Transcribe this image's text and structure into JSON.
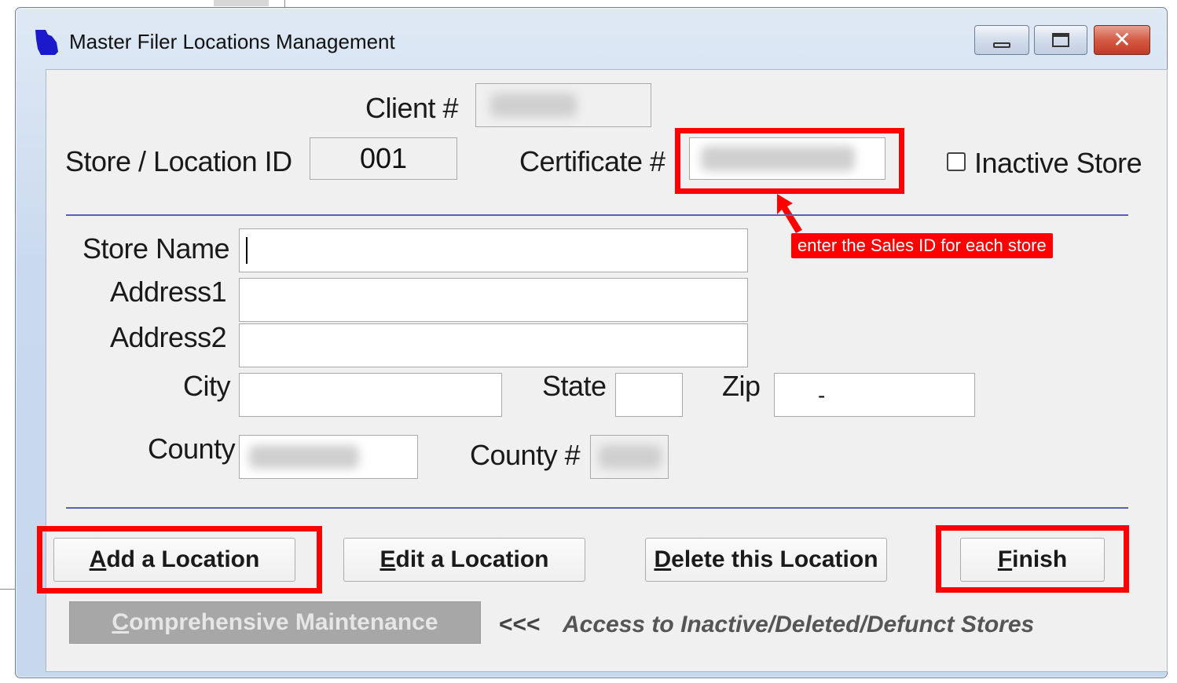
{
  "window": {
    "title": "Master Filer Locations Management",
    "minimize_glyph": "",
    "close_glyph": "✕"
  },
  "header": {
    "client_label": "Client #",
    "store_id_label": "Store / Location ID",
    "store_id_value": "001",
    "certificate_label": "Certificate #",
    "inactive_label": "Inactive Store"
  },
  "annotation": {
    "callout_text": "enter the Sales ID for each store",
    "highlight_color": "#ff0000"
  },
  "form": {
    "store_name_label": "Store Name",
    "address1_label": "Address1",
    "address2_label": "Address2",
    "city_label": "City",
    "state_label": "State",
    "zip_label": "Zip",
    "zip_value": "-",
    "county_label": "County",
    "county_num_label": "County #"
  },
  "buttons": {
    "add_location": {
      "access_key": "A",
      "rest": "dd a Location"
    },
    "edit_location": {
      "access_key": "E",
      "rest": "dit a Location"
    },
    "delete_location": {
      "access_key": "D",
      "rest": "elete this Location"
    },
    "finish": {
      "access_key": "F",
      "rest": "inish"
    },
    "comprehensive": {
      "access_key": "C",
      "rest": "omprehensive Maintenance"
    }
  },
  "footer": {
    "arrows": "<<<",
    "hint": "Access to Inactive/Deleted/Defunct Stores"
  },
  "colors": {
    "accent_line": "#5a5fb8",
    "highlight": "#ff0000",
    "app_icon": "#1a1acc"
  },
  "icons": [
    "app-icon",
    "minimize-icon",
    "maximize-icon",
    "close-icon",
    "annotation-arrow-icon"
  ]
}
